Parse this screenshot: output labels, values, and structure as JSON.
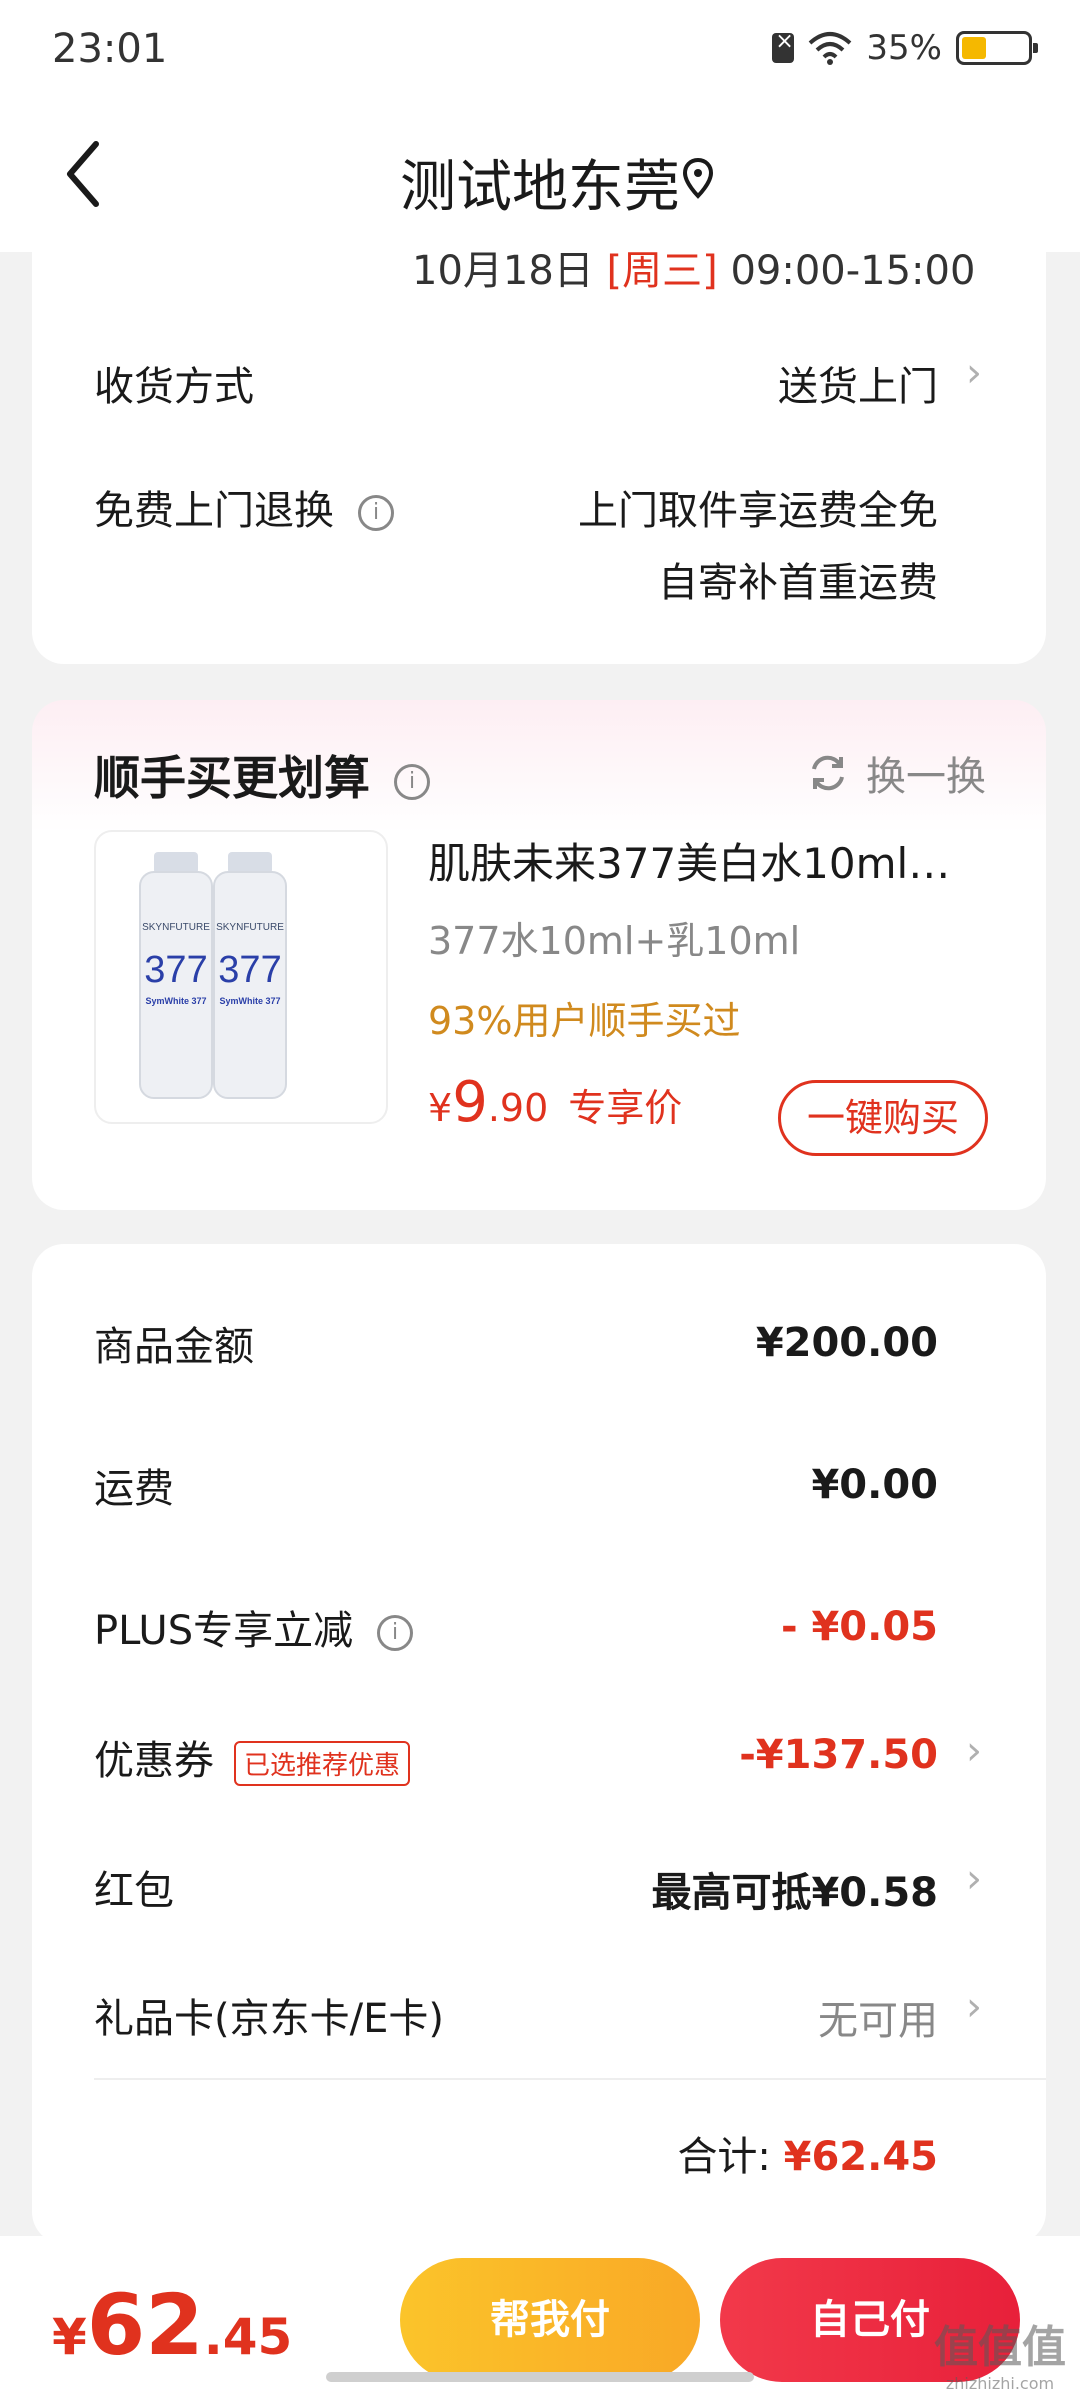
{
  "status_bar": {
    "time": "23:01",
    "battery": "35%"
  },
  "header": {
    "title": "测试地东莞",
    "back_icon": "chevron-left-icon",
    "location_icon": "location-pin-icon"
  },
  "delivery": {
    "cut_text_date": "10月18日",
    "cut_text_day": "[周三]",
    "cut_text_time": "09:00-15:00",
    "method_label": "收货方式",
    "method_value": "送货上门",
    "return_label": "免费上门退换",
    "return_value_line1": "上门取件享运费全免",
    "return_value_line2": "自寄补首重运费"
  },
  "upsell": {
    "title": "顺手买更划算",
    "refresh_label": "换一换",
    "product": {
      "name": "肌肤未来377美白水10ml…",
      "spec": "377水10ml+乳10ml",
      "bought": "93%用户顺手买过",
      "price_currency": "¥",
      "price_int": "9",
      "price_dec": ".90",
      "price_tag": "专享价",
      "buy_label": "一键购买",
      "image_brand": "SKYNFUTURE",
      "image_number": "377",
      "image_line": "SymWhite 377"
    }
  },
  "summary": {
    "rows": [
      {
        "label": "商品金额",
        "value": "¥200.00"
      },
      {
        "label": "运费",
        "value": "¥0.00"
      },
      {
        "label": "PLUS专享立减",
        "value": "- ¥0.05"
      },
      {
        "label": "优惠券",
        "tag": "已选推荐优惠",
        "value": "-¥137.50"
      },
      {
        "label": "红包",
        "value": "最高可抵¥0.58"
      },
      {
        "label": "礼品卡(京东卡/E卡)",
        "value": "无可用"
      }
    ],
    "total_label": "合计:",
    "total_value": "¥62.45"
  },
  "bottom_bar": {
    "price_currency": "¥",
    "price_int": "62",
    "price_dec": ".45",
    "help_pay_label": "帮我付",
    "self_pay_label": "自己付"
  },
  "watermark": {
    "main": "值值值",
    "sub": "zhizhizhi.com"
  },
  "colors": {
    "accent_red": "#e0321e",
    "gold": "#d08a1e",
    "help_yellow": "#fbc42a",
    "pay_red": "#e8203a"
  }
}
